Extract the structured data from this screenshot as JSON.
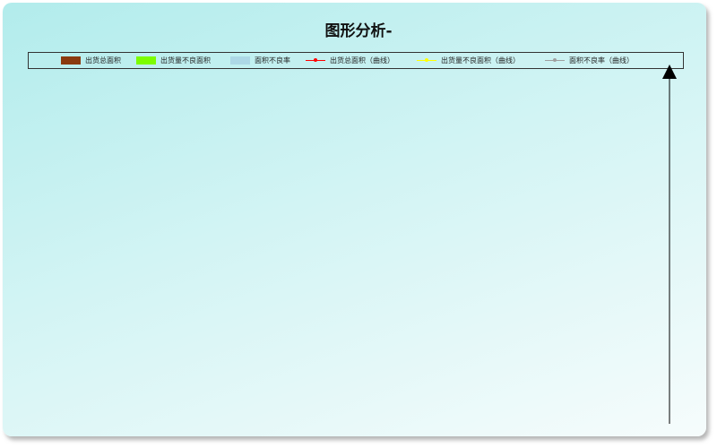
{
  "chart_data": {
    "type": "bar",
    "title": "图形分析-",
    "categories": [],
    "series": [
      {
        "name": "出货总面积",
        "kind": "bar",
        "color": "#8b3a0f",
        "values": []
      },
      {
        "name": "出货量不良面积",
        "kind": "bar",
        "color": "#7cfc00",
        "values": []
      },
      {
        "name": "面积不良率",
        "kind": "bar",
        "color": "#add8e6",
        "values": []
      },
      {
        "name": "出货总面积（曲线）",
        "kind": "line",
        "color": "#ff0000",
        "values": []
      },
      {
        "name": "出货量不良面积（曲线）",
        "kind": "line",
        "color": "#ffff00",
        "values": []
      },
      {
        "name": "面积不良率（曲线）",
        "kind": "line",
        "color": "#a0a0a0",
        "values": []
      }
    ],
    "legend_position": "top",
    "colors": {
      "background_start": "#b2ecec",
      "background_end": "#f6fcfc",
      "axis": "#000000"
    }
  }
}
